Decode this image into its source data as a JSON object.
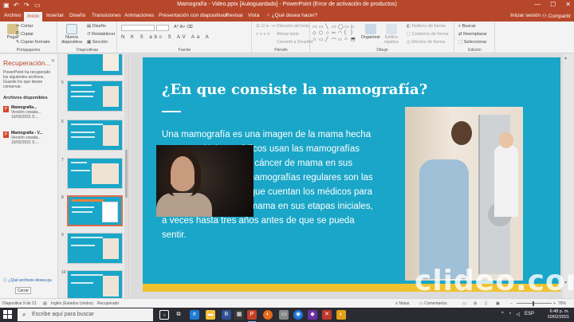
{
  "window": {
    "title": "Mamografía - Video.pptx [Autoguardado] - PowerPoint (Error de activación de productos)",
    "controls": [
      "—",
      "☐",
      "✕"
    ]
  },
  "tabs": {
    "items": [
      "Archivo",
      "Inicio",
      "Insertar",
      "Diseño",
      "Transiciones",
      "Animaciones",
      "Presentación con diapositivas",
      "Revisar",
      "Vista"
    ],
    "active": "Inicio",
    "tell_me": "¿Qué desea hacer?",
    "sign_in": "Iniciar sesión",
    "share": "Compartir"
  },
  "ribbon": {
    "clipboard": {
      "label": "Portapapeles",
      "paste": "Pegar",
      "cut": "Cortar",
      "copy": "Copiar",
      "format_painter": "Copiar formato"
    },
    "slides": {
      "label": "Diapositivas",
      "new_slide": "Nueva diapositiva",
      "layout": "Diseño",
      "reset": "Restablecer",
      "section": "Sección"
    },
    "font": {
      "label": "Fuente",
      "format_row": "N K S abc S AV Aa A"
    },
    "paragraph": {
      "label": "Párrafo",
      "text_direction": "Dirección del texto",
      "align_text": "Alinear texto",
      "smartart": "Convertir a SmartArt"
    },
    "drawing": {
      "label": "Dibujo",
      "arrange": "Organizar",
      "quick_styles": "Estilos rápidos",
      "shape_fill": "Relleno de forma",
      "shape_outline": "Contorno de forma",
      "shape_effects": "Efectos de forma"
    },
    "editing": {
      "label": "Edición",
      "find": "Buscar",
      "replace": "Reemplazar",
      "select": "Seleccionar"
    }
  },
  "recovery_pane": {
    "title": "Recuperación...",
    "description": "PowerPoint ha recuperado los siguientes archivos. Guarde los que desee conservar.",
    "available_label": "Archivos disponibles",
    "files": [
      {
        "name": "Mamografía...",
        "version": "Versión creada...",
        "date": "10/02/2021 5:..."
      },
      {
        "name": "Mamografía - V...",
        "version": "Versión creada...",
        "date": "10/02/2021 5:..."
      }
    ],
    "link": "¿Qué archivos desea gu",
    "close_button": "Cerrar"
  },
  "thumbnails": [
    {
      "number": "5"
    },
    {
      "number": "6"
    },
    {
      "number": "7"
    },
    {
      "number": "8"
    },
    {
      "number": "9"
    },
    {
      "number": "10"
    }
  ],
  "slide": {
    "title": "¿En que consiste la mamografía?",
    "body": "Una mamografía es una imagen de la mama hecha con rayos X. Los médicos usan las mamografías para buscar signos de cáncer de mama en sus etapas iniciales. Las mamografías regulares son las mejores pruebas con que cuentan los médicos para detectar el cáncer de mama en sus etapas iniciales, a veces hasta tres años antes de que se pueda sentir.",
    "colors": {
      "background": "#1aa6c8",
      "accent_bar": "#f0c230"
    }
  },
  "watermark": "clideo.com",
  "statusbar": {
    "slide_info": "Diapositiva 9 de 21",
    "language": "Inglés (Estados Unidos)",
    "recovered": "Recuperado",
    "notes": "Notas",
    "comments": "Comentarios",
    "zoom": "76%"
  },
  "taskbar": {
    "search_placeholder": "Escribe aquí para buscar",
    "language": "ESP",
    "time": "6:48 p. m.",
    "date": "10/02/2021"
  }
}
